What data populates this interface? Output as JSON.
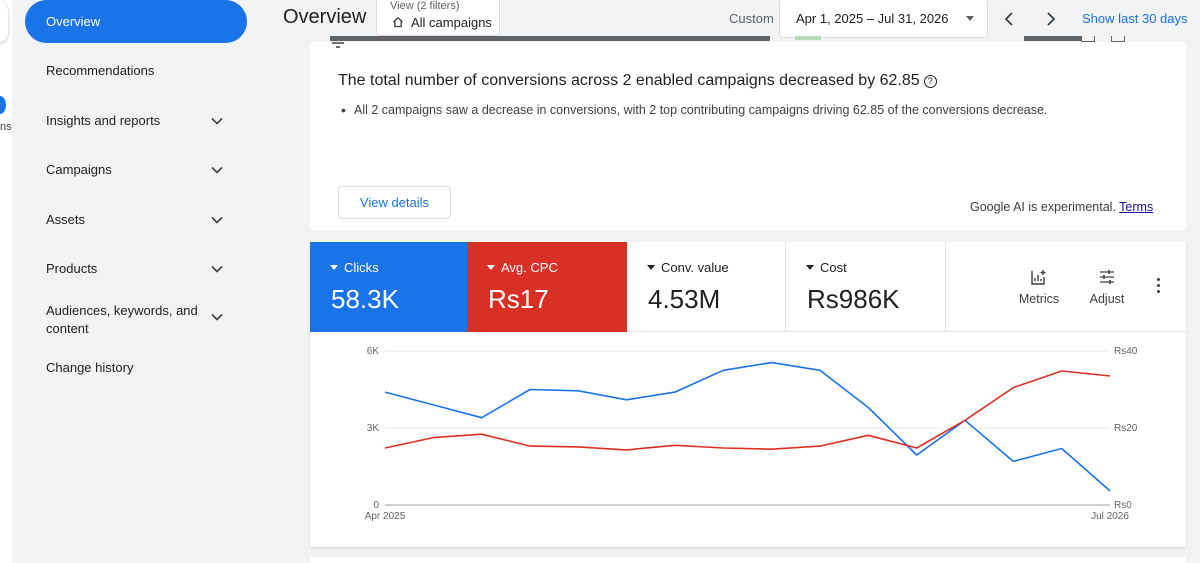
{
  "rail": {
    "partial_text": "ns"
  },
  "sidebar": {
    "items": [
      {
        "label": "Overview"
      },
      {
        "label": "Recommendations"
      },
      {
        "label": "Insights and reports"
      },
      {
        "label": "Campaigns"
      },
      {
        "label": "Assets"
      },
      {
        "label": "Products"
      },
      {
        "label": "Audiences, keywords, and content"
      },
      {
        "label": "Change history"
      }
    ]
  },
  "header": {
    "title": "Overview",
    "filter_small": "View (2 filters)",
    "filter_main": "All campaigns",
    "date_mode": "Custom",
    "date_range": "Apr 1, 2025 – Jul 31, 2026",
    "show_last": "Show last 30 days"
  },
  "insight": {
    "headline": "The total number of conversions across 2 enabled campaigns decreased by 62.85",
    "bullet": "All 2 campaigns saw a decrease in conversions, with 2 top contributing campaigns driving 62.85 of the conversions decrease.",
    "view_details": "View details",
    "ai_note": "Google AI is experimental.",
    "terms": "Terms"
  },
  "metrics": [
    {
      "label": "Clicks",
      "value": "58.3K",
      "color": "#1a73e8"
    },
    {
      "label": "Avg. CPC",
      "value": "Rs17",
      "color": "#d93025"
    },
    {
      "label": "Conv. value",
      "value": "4.53M"
    },
    {
      "label": "Cost",
      "value": "Rs986K"
    }
  ],
  "tools": {
    "metrics": "Metrics",
    "adjust": "Adjust"
  },
  "chart_data": {
    "type": "line",
    "x": [
      "Apr 2025",
      "May 2025",
      "Jun 2025",
      "Jul 2025",
      "Aug 2025",
      "Sep 2025",
      "Oct 2025",
      "Nov 2025",
      "Dec 2025",
      "Jan 2026",
      "Feb 2026",
      "Mar 2026",
      "Apr 2026",
      "May 2026",
      "Jun 2026",
      "Jul 2026"
    ],
    "x_tick_labels": [
      "Apr 2025",
      "Jul 2026"
    ],
    "left_axis": {
      "ticks": [
        "0",
        "3K",
        "6K"
      ],
      "ylim": [
        0,
        6000
      ]
    },
    "right_axis": {
      "ticks": [
        "Rs0",
        "Rs20",
        "Rs40"
      ],
      "ylim": [
        0,
        40
      ]
    },
    "series": [
      {
        "name": "Clicks",
        "axis": "left",
        "color": "#1a73e8",
        "values": [
          4400,
          3900,
          3400,
          4500,
          4450,
          4100,
          4400,
          5250,
          5550,
          5250,
          3800,
          1950,
          3300,
          1700,
          2200,
          550
        ]
      },
      {
        "name": "Avg. CPC",
        "axis": "right",
        "color": "#d93025",
        "values": [
          14.8,
          17.5,
          18.4,
          15.3,
          15.1,
          14.3,
          15.5,
          14.8,
          14.5,
          15.3,
          18.1,
          14.8,
          22.0,
          30.5,
          34.8,
          33.5
        ]
      }
    ],
    "grid": true
  }
}
